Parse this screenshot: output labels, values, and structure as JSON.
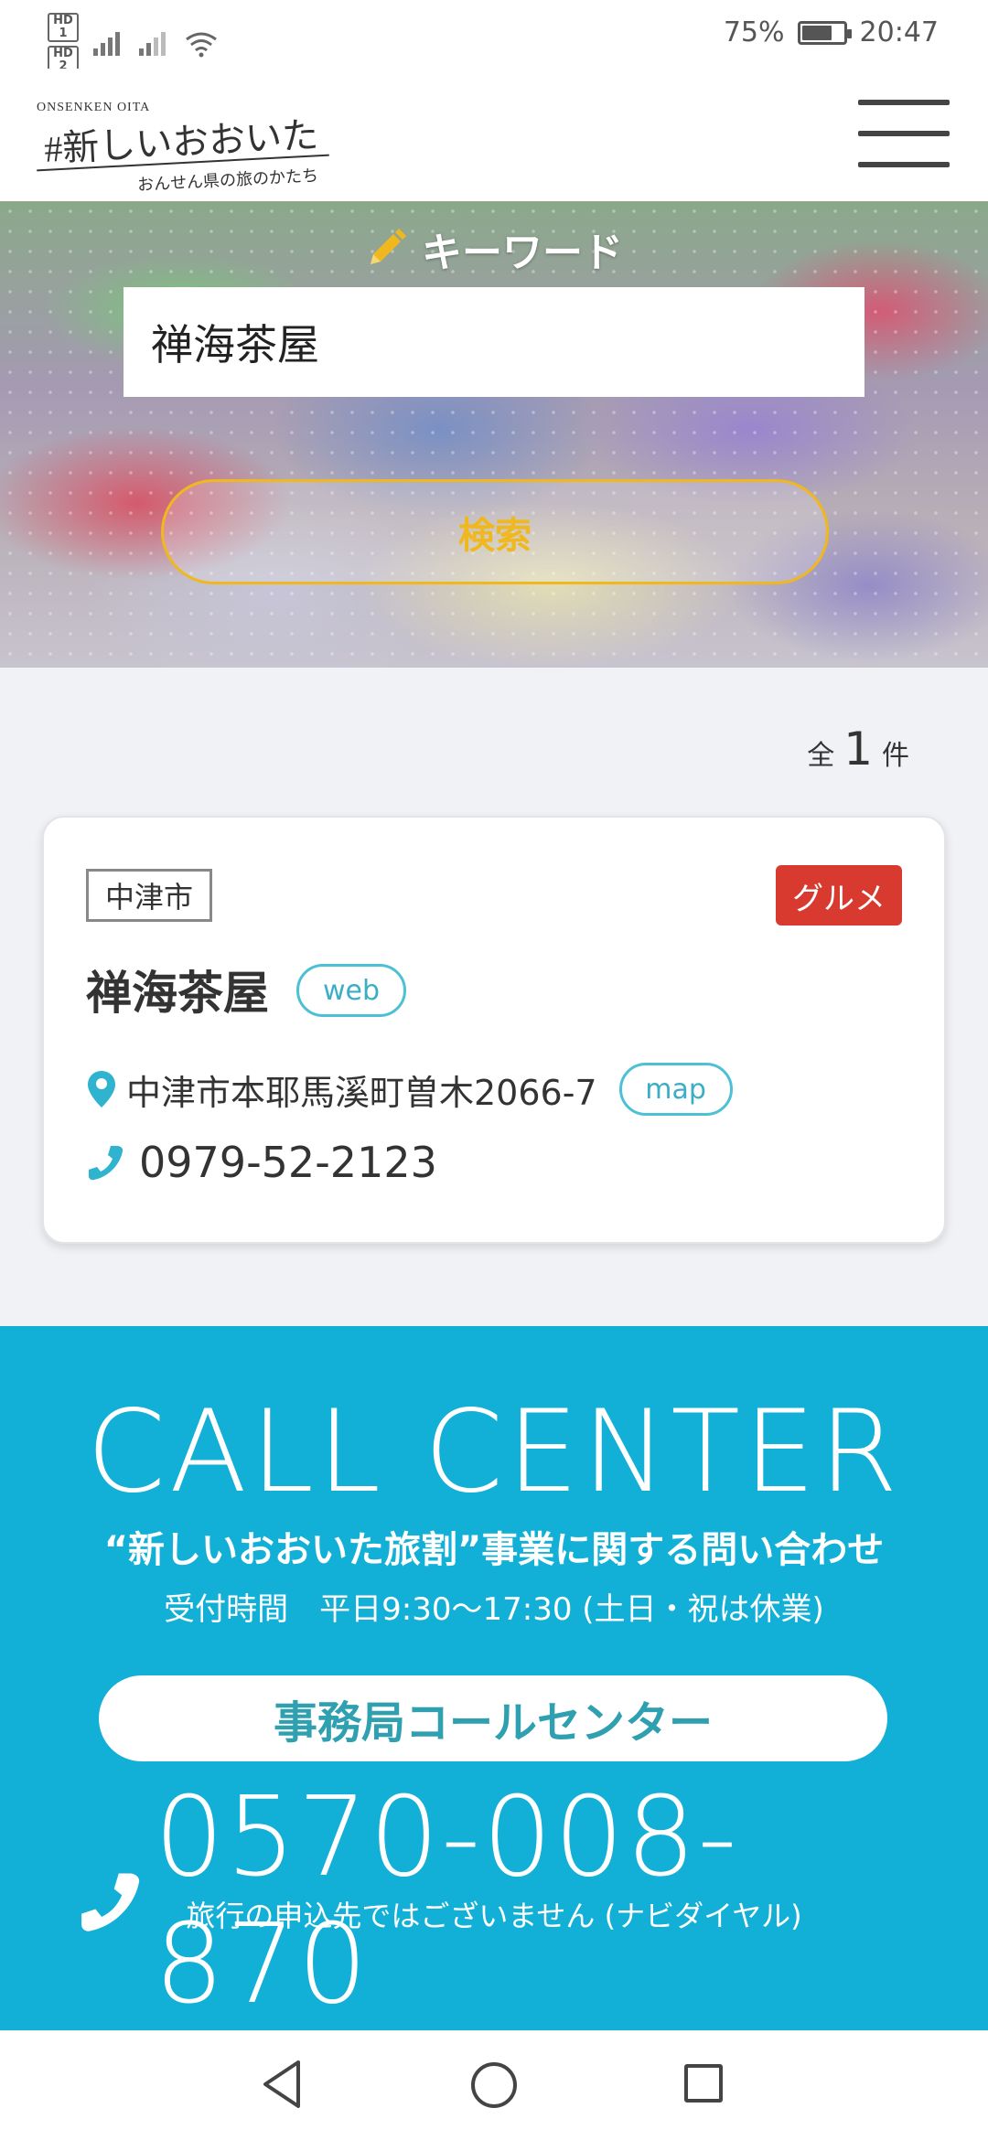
{
  "status_bar": {
    "sim1": "HD 1",
    "sim2": "HD 2",
    "battery_text": "75%",
    "battery_level": 0.75,
    "time": "20:47"
  },
  "header": {
    "logo_top": "ONSENKEN OITA",
    "logo_main": "#新しいおおいた",
    "logo_sub": "おんせん県の旅のかたち"
  },
  "search": {
    "label": "キーワード",
    "keyword_value": "禅海茶屋",
    "button_label": "検索"
  },
  "results": {
    "count_prefix": "全",
    "count": "1",
    "count_suffix": "件",
    "items": [
      {
        "city": "中津市",
        "category": "グルメ",
        "name": "禅海茶屋",
        "web_label": "web",
        "address": "中津市本耶馬溪町曽木2066-7",
        "map_label": "map",
        "tel": "0979-52-2123"
      }
    ]
  },
  "call_center": {
    "title": "CALL CENTER",
    "subtitle": "“新しいおおいた旅割”事業に関する問い合わせ",
    "hours": "受付時間　平日9:30～17:30 (土日・祝は休業)",
    "office_button": "事務局コールセンター",
    "phone": "0570-008-870",
    "note": "旅行の申込先ではございません (ナビダイヤル)"
  },
  "colors": {
    "accent_yellow": "#f0b81e",
    "accent_blue": "#12b0d6",
    "badge_red": "#d93a30",
    "link_teal": "#4cc0d4"
  }
}
